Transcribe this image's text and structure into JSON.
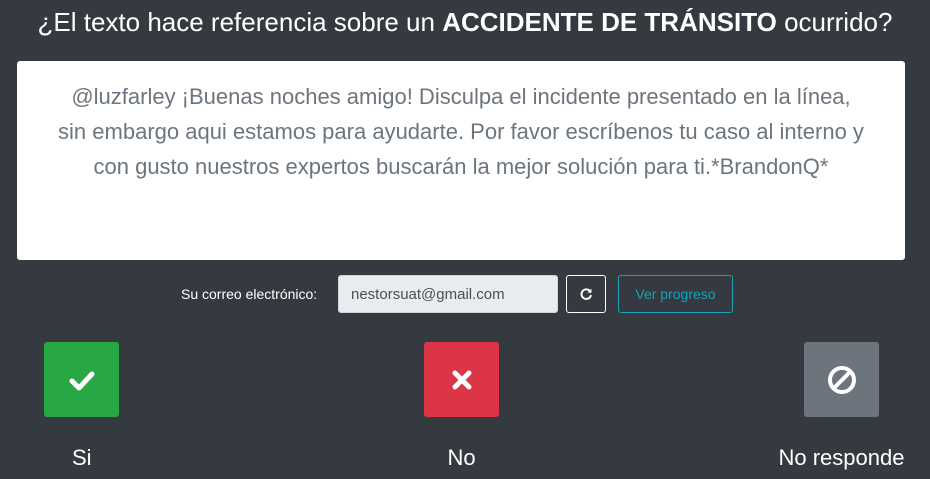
{
  "question": {
    "prefix": "¿El texto hace referencia sobre un ",
    "emphasis": "ACCIDENTE DE TRÁNSITO",
    "suffix": " ocurrido?"
  },
  "text_card": {
    "content": "@luzfarley ¡Buenas noches amigo! Disculpa el incidente presentado en la línea, sin embargo aqui estamos para ayudarte. Por favor escríbenos tu caso al interno y con gusto nuestros expertos buscarán la mejor solución para ti.*BrandonQ*"
  },
  "email": {
    "label": "Su correo electrónico:",
    "value": "nestorsuat@gmail.com"
  },
  "buttons": {
    "refresh_icon": "refresh-icon",
    "progress_label": "Ver progreso"
  },
  "answers": [
    {
      "label": "Si",
      "icon": "check-icon",
      "color": "#28a745"
    },
    {
      "label": "No",
      "icon": "x-icon",
      "color": "#dc3545"
    },
    {
      "label": "No responde",
      "icon": "ban-icon",
      "color": "#6c757d"
    }
  ]
}
